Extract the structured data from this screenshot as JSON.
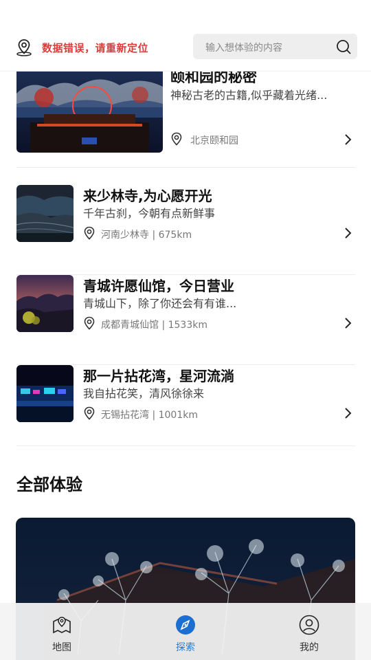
{
  "header": {
    "location_text": "数据错误，请重新定位",
    "search_placeholder": "输入想体验的内容"
  },
  "featured": {
    "title": "颐和园的秘密",
    "subtitle": "神秘古老的古籍,似乎藏着光绪...",
    "location": "北京颐和园"
  },
  "items": [
    {
      "title": "来少林寺,为心愿开光",
      "subtitle": "千年古刹，今朝有点新鲜事",
      "location": "河南少林寺 | 675km"
    },
    {
      "title": "青城许愿仙馆，今日营业",
      "subtitle": "青城山下，除了你还会有有谁...",
      "location": "成都青城仙馆 | 1533km"
    },
    {
      "title": "那一片拈花湾，星河流淌",
      "subtitle": "我自拈花笑，清风徐徐来",
      "location": "无锡拈花湾 | 1001km"
    }
  ],
  "section": {
    "title": "全部体验"
  },
  "tabbar": {
    "tabs": [
      {
        "label": "地图",
        "icon": "map-pin-icon",
        "active": false
      },
      {
        "label": "探索",
        "icon": "compass-icon",
        "active": true
      },
      {
        "label": "我的",
        "icon": "user-icon",
        "active": false
      }
    ]
  },
  "colors": {
    "alert": "#e23a3a",
    "accent": "#1b7bd6"
  }
}
